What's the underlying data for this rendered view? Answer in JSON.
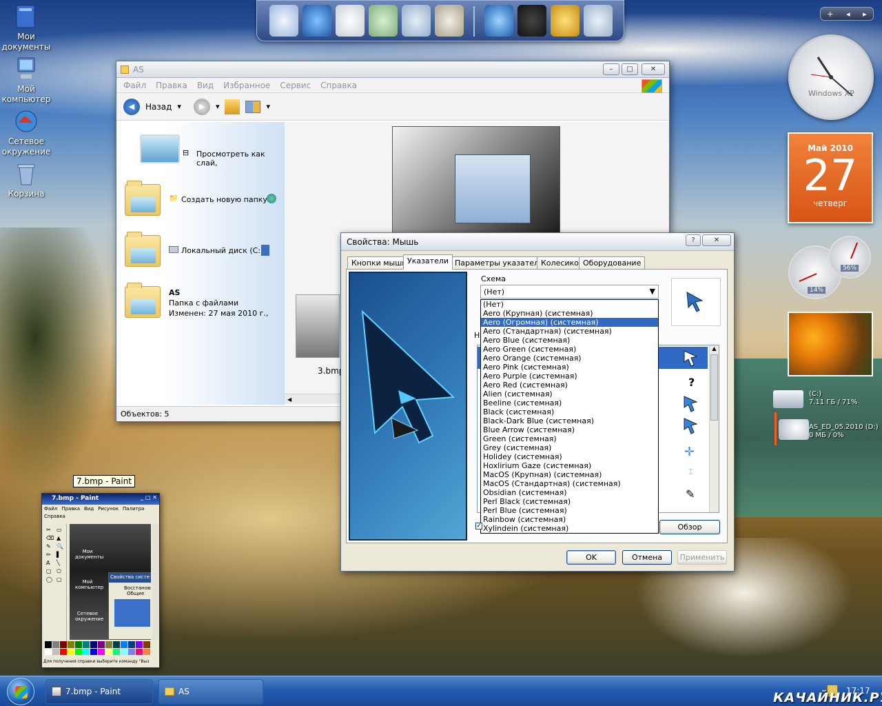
{
  "desktop_icons": [
    {
      "label": "Мои документы",
      "icon": "my-documents-icon"
    },
    {
      "label": "Мой компьютер",
      "icon": "my-computer-icon"
    },
    {
      "label": "Сетевое окружение",
      "icon": "network-icon"
    },
    {
      "label": "Корзина",
      "icon": "recycle-bin-icon"
    }
  ],
  "dock": {
    "icons": [
      "computer-icon",
      "globe-icon",
      "documents-icon",
      "folder-icon",
      "pictures-icon",
      "tools-icon",
      "internet-icon",
      "tshirt-icon",
      "settings-icon",
      "recycle-icon"
    ]
  },
  "explorer": {
    "title": "AS",
    "menu": [
      "Файл",
      "Правка",
      "Вид",
      "Избранное",
      "Сервис",
      "Справка"
    ],
    "back_label": "Назад",
    "tasks": [
      {
        "label": "Просмотреть как слай,"
      },
      {
        "label": "Создать новую папку"
      },
      {
        "label": "Локальный диск (C:)"
      }
    ],
    "folder_info": {
      "name": "AS",
      "type": "Папка с файлами",
      "modified": "Изменен: 27 мая 2010 г.,"
    },
    "thumb_label": "3.bmp",
    "status": "Объектов: 5"
  },
  "dialog": {
    "title": "Свойства: Мышь",
    "help": "?",
    "close": "✕",
    "tabs": [
      "Кнопки мыши",
      "Указатели",
      "Параметры указателя",
      "Колесико",
      "Оборудование"
    ],
    "active_tab": 1,
    "scheme_label": "Схема",
    "scheme_value": "(Нет)",
    "settings_label_fragment": "Н",
    "browse": "Обзор",
    "ok": "OK",
    "cancel": "Отмена",
    "apply": "Применить",
    "dropdown_options": [
      "(Нет)",
      "Aero (Крупная) (системная)",
      "Aero (Огромная) (системная)",
      "Aero (Стандартная) (системная)",
      "Aero Blue (системная)",
      "Aero Green (системная)",
      "Aero Orange (системная)",
      "Aero Pink (системная)",
      "Aero Purple (системная)",
      "Aero Red (системная)",
      "Alien (системная)",
      "Beeline (системная)",
      "Black (системная)",
      "Black-Dark Blue (системная)",
      "Blue Arrow (системная)",
      "Green (системная)",
      "Grey (системная)",
      "Holidey (системная)",
      "Hoxlirium Gaze (системная)",
      "MacOS (Крупная) (системная)",
      "MacOS (Стандартная) (системная)",
      "Obsidian (системная)",
      "Perl Black (системная)",
      "Perl Blue (системная)",
      "Rainbow (системная)",
      "Xylindein (системная)"
    ],
    "selected_option": 2
  },
  "paint": {
    "tooltip": "7.bmp - Paint",
    "title": "7.bmp - Paint",
    "menu": [
      "Файл",
      "Правка",
      "Вид",
      "Рисунок",
      "Палитра",
      "Справка"
    ],
    "canvas_labels": [
      "Мои документы",
      "Мой компьютер",
      "Сетевое окружение"
    ],
    "canvas_dialog_title": "Свойства систе",
    "canvas_tab": "Восстанови",
    "canvas_tab2": "Общие",
    "status": "Для получения справки выберите команду \"Выз"
  },
  "sidebar": {
    "clock_text": "Windows XP",
    "calendar": {
      "month": "Май 2010",
      "day": "27",
      "weekday": "четверг"
    },
    "gauge1": "14%",
    "gauge2": "56%",
    "drives": [
      {
        "name": "(C:)",
        "info": "7.11 ГБ / 71%"
      },
      {
        "name": "AS_ED_05.2010 (D:)",
        "info": "0 МБ / 0%"
      }
    ],
    "buttons": [
      "+",
      "◂",
      "▸"
    ]
  },
  "taskbar": {
    "buttons": [
      {
        "label": "7.bmp - Paint"
      },
      {
        "label": "AS"
      }
    ],
    "clock": "17:17",
    "watermark": "КАЧАЙНИК.РУ"
  },
  "colors": {
    "accent": "#316ac5",
    "calendar": "#e8641e",
    "taskbar": "#245bb0"
  }
}
